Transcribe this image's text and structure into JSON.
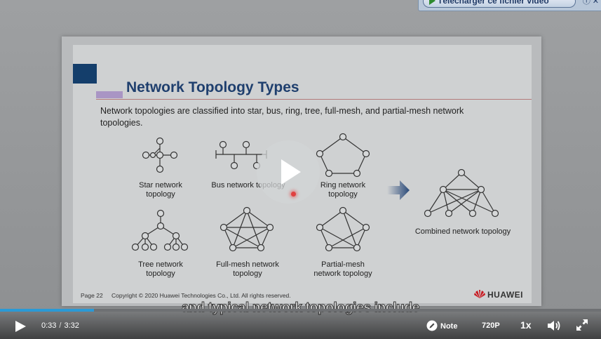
{
  "download_banner": {
    "label": "Télécharger ce fichier vidéo"
  },
  "slide": {
    "title": "Network Topology Types",
    "intro": "Network topologies are classified into star, bus, ring, tree, full-mesh, and partial-mesh network topologies.",
    "diagrams": {
      "star": "Star network topology",
      "bus": "Bus network topology",
      "ring": "Ring network topology",
      "tree": "Tree network topology",
      "full_mesh": "Full-mesh network topology",
      "partial_mesh": "Partial-mesh network topology",
      "combined": "Combined network topology"
    },
    "footer": {
      "page": "Page 22",
      "copyright": "Copyright © 2020 Huawei Technologies Co., Ltd. All rights reserved.",
      "logo": "HUAWEI"
    }
  },
  "player": {
    "subtitle": "and typical network topologies include",
    "current_time": "0:33",
    "separator": "/",
    "duration": "3:32",
    "progress_fraction": 0.156,
    "note_label": "Note",
    "quality_label": "720P",
    "speed_label": "1x",
    "icons": [
      "play-icon",
      "pencil-icon",
      "volume-icon",
      "fullscreen-icon"
    ],
    "accent_color": "#2a9ad6"
  }
}
